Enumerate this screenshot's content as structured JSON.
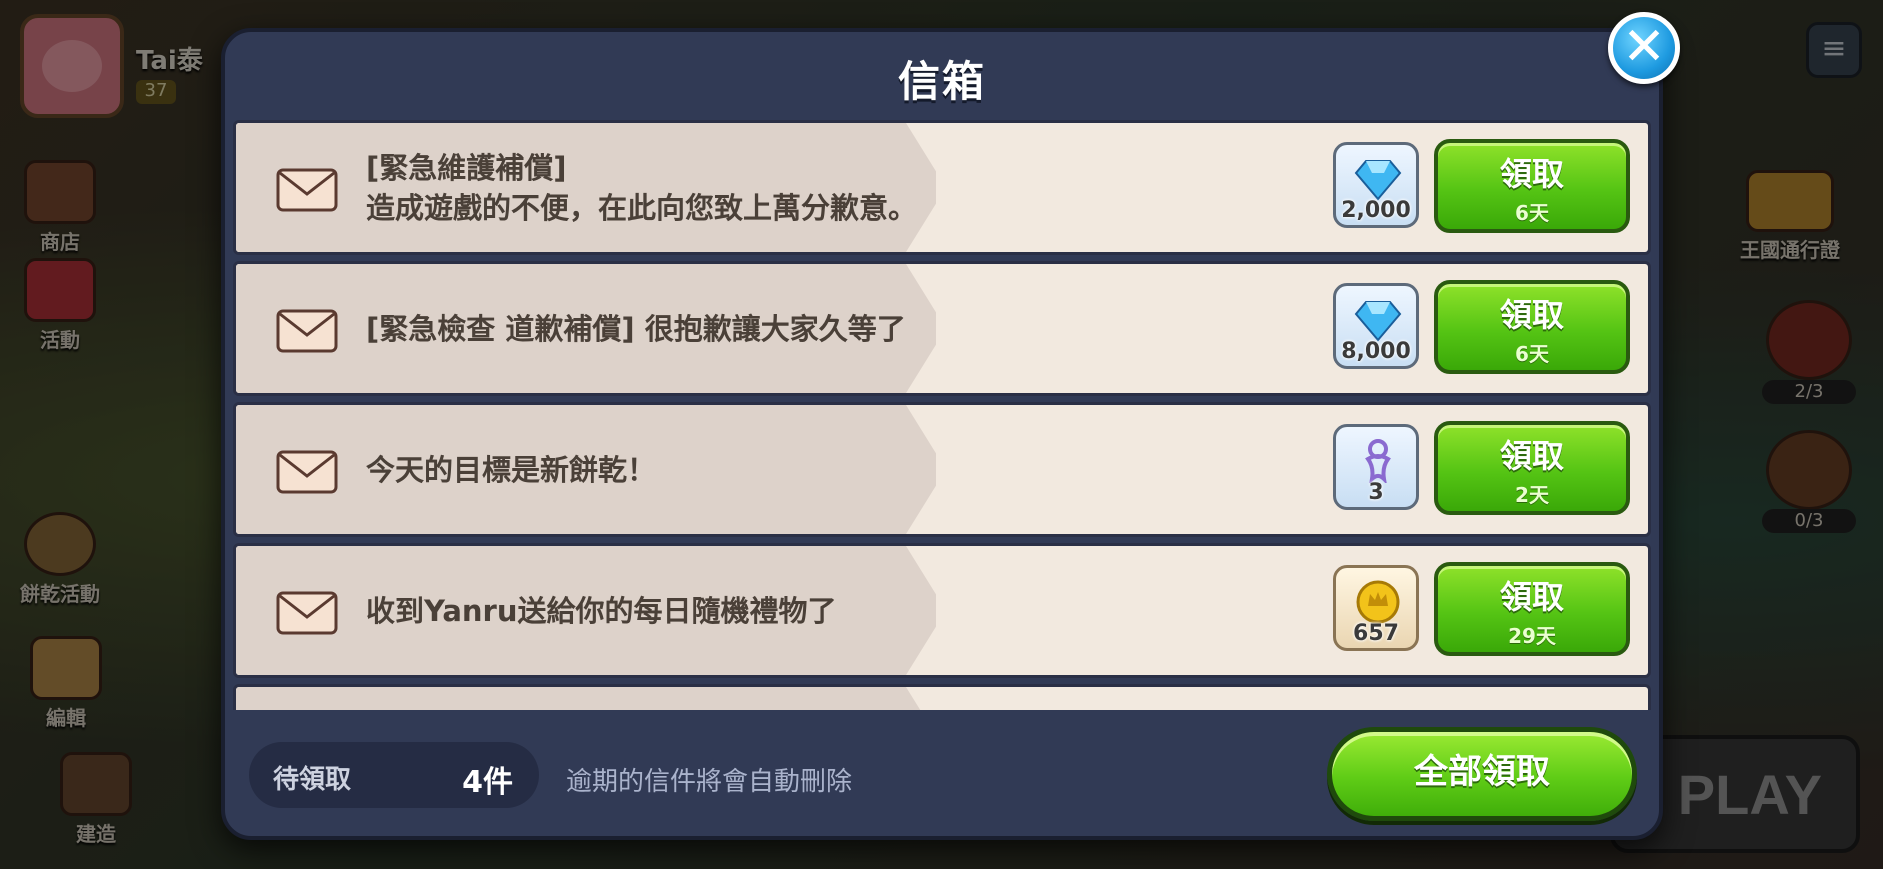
{
  "background": {
    "player": {
      "name": "Tai泰",
      "level": "37"
    },
    "left_menu": [
      {
        "label": "商店"
      },
      {
        "label": "活動"
      },
      {
        "label": "餅乾活動"
      },
      {
        "label": "編輯"
      },
      {
        "label": "建造"
      }
    ],
    "right_menu": [
      {
        "label": "王國通行證"
      }
    ],
    "counters": [
      "2/3",
      "0/3"
    ],
    "play_label": "PLAY"
  },
  "dialog": {
    "title": "信箱",
    "close_icon": "close-icon",
    "mails": [
      {
        "line1": "[緊急維護補償]",
        "line2": "造成遊戲的不便，在此向您致上萬分歉意。",
        "reward": {
          "icon": "crystal-icon",
          "qty": "2,000"
        },
        "claim_label": "領取",
        "days": "6天"
      },
      {
        "line1": "[緊急檢查 道歉補償] 很抱歉讓大家久等了",
        "line2": "",
        "reward": {
          "icon": "crystal-icon",
          "qty": "8,000"
        },
        "claim_label": "領取",
        "days": "6天"
      },
      {
        "line1": "今天的目標是新餅乾！",
        "line2": "",
        "reward": {
          "icon": "cookie-cutter-icon",
          "qty": "3"
        },
        "claim_label": "領取",
        "days": "2天"
      },
      {
        "line1": "收到Yanru送給你的每日隨機禮物了",
        "line2": "",
        "reward": {
          "icon": "coin-icon",
          "qty": "657"
        },
        "claim_label": "領取",
        "days": "29天"
      }
    ],
    "footer": {
      "pending_label": "待領取",
      "pending_count": "4件",
      "notice": "逾期的信件將會自動刪除",
      "claim_all_label": "全部領取"
    }
  },
  "colors": {
    "dialog_bg": "#313a55",
    "card_bg": "#f2e9df",
    "band_bg": "#ddd2ca",
    "button_green": "#55c414",
    "close_blue": "#1e9ae0"
  }
}
